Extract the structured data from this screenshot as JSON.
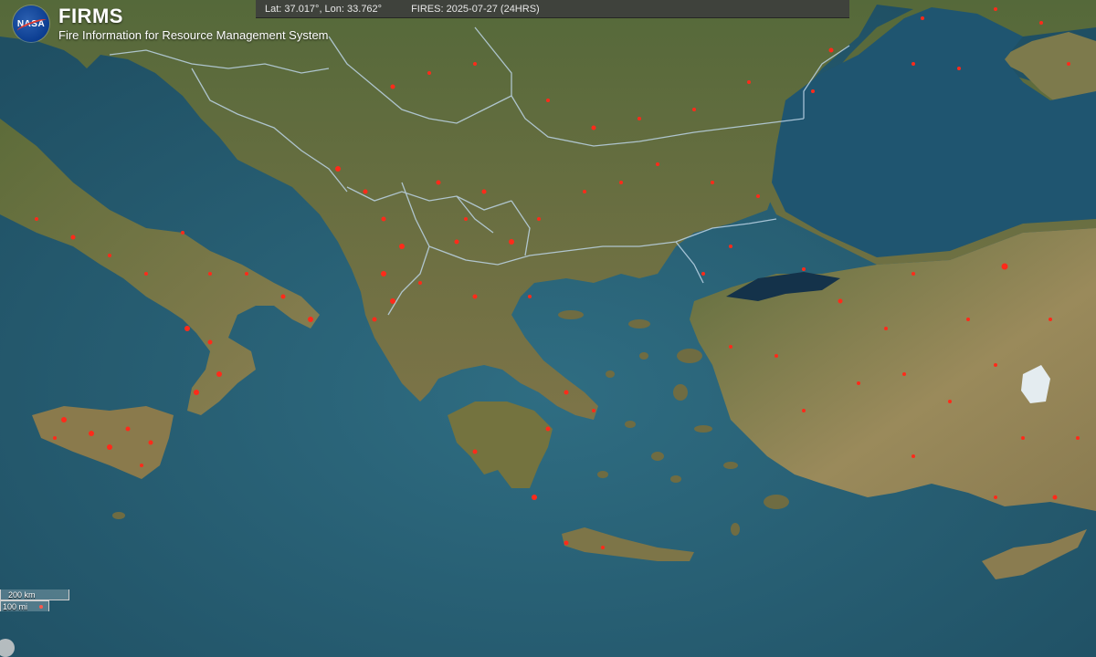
{
  "header": {
    "logo_text": "NASA",
    "title": "FIRMS",
    "subtitle": "Fire Information for Resource Management System"
  },
  "info_bar": {
    "coordinates": "Lat: 37.017°, Lon: 33.762°",
    "fires": "FIRES: 2025-07-27 (24HRS)"
  },
  "scale_bar": {
    "km_label": "200 km",
    "mi_label": "100 mi"
  },
  "map": {
    "type": "satellite imagery",
    "region": "Balkans, Aegean, Anatolia",
    "fire_color": "#ff2a1a",
    "border_color": "#bcd4e6"
  }
}
